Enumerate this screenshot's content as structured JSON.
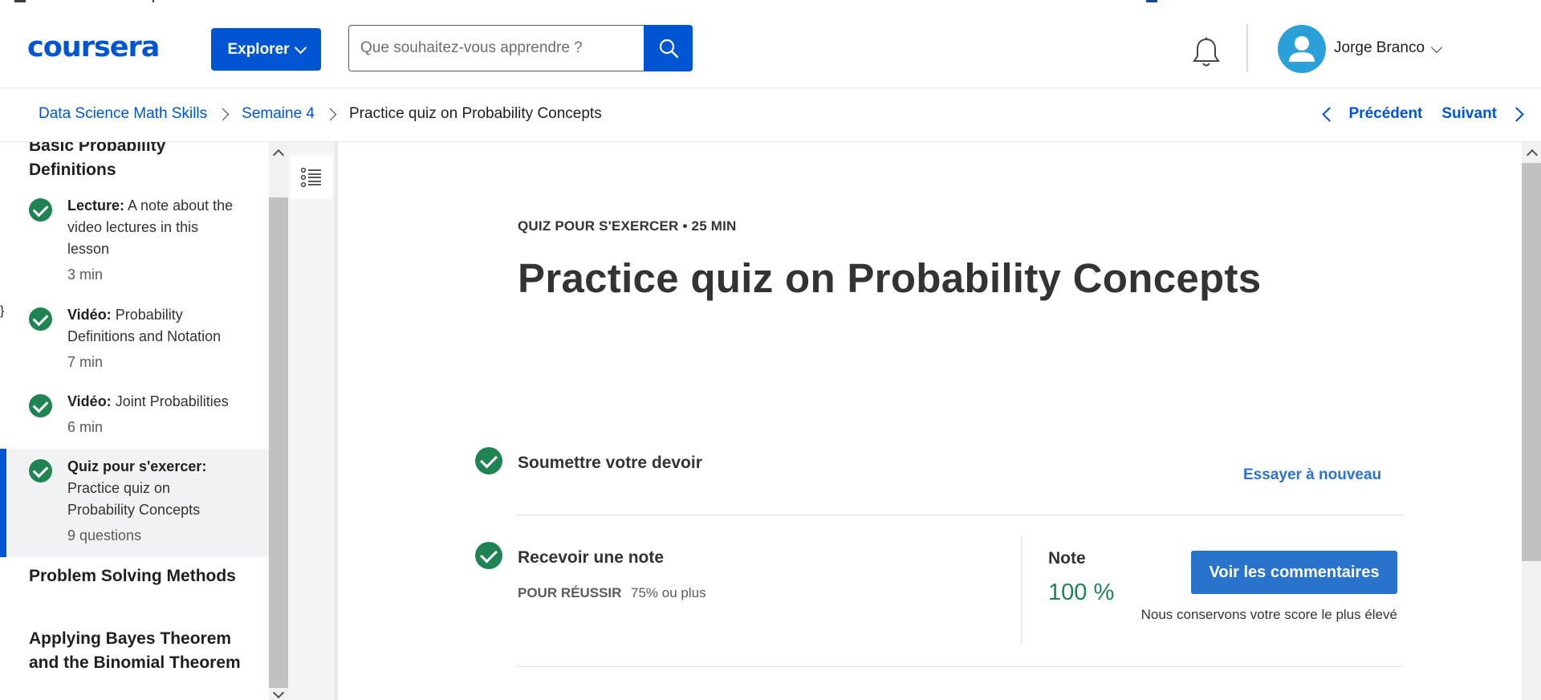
{
  "header": {
    "logo": "coursera",
    "explore_label": "Explorer",
    "search_placeholder": "Que souhaitez-vous apprendre ?",
    "user_name": "Jorge Branco"
  },
  "breadcrumb": {
    "items": [
      "Data Science Math Skills",
      "Semaine 4"
    ],
    "current": "Practice quiz on Probability Concepts",
    "prev_label": "Précédent",
    "next_label": "Suivant"
  },
  "sidebar": {
    "section_title": "Basic Probability Definitions",
    "items": [
      {
        "kind": "Lecture:",
        "title": "A note about the video lectures in this lesson",
        "duration": "3 min"
      },
      {
        "kind": "Vidéo:",
        "title": "Probability Definitions and Notation",
        "duration": "7 min"
      },
      {
        "kind": "Vidéo:",
        "title": "Joint Probabilities",
        "duration": "6 min"
      },
      {
        "kind": "Quiz pour s'exercer:",
        "title": "Practice quiz on Probability Concepts",
        "duration": "9 questions"
      }
    ],
    "next_sections": [
      "Problem Solving Methods",
      "Applying Bayes Theorem and the Binomial Theorem"
    ]
  },
  "main": {
    "kicker": "QUIZ POUR S'EXERCER • 25 MIN",
    "title": "Practice quiz on Probability Concepts",
    "step1_title": "Soumettre votre devoir",
    "retry_label": "Essayer à nouveau",
    "step2_title": "Recevoir une note",
    "pass_label": "POUR RÉUSSIR",
    "pass_value": "75% ou plus",
    "grade_label": "Note",
    "grade_value": "100 %",
    "feedback_label": "Voir les commentaires",
    "keep_note": "Nous conservons votre score le plus élevé"
  },
  "colors": {
    "brand_blue": "#0056d2",
    "link_blue": "#2a73cc",
    "success_green": "#1f8354"
  }
}
